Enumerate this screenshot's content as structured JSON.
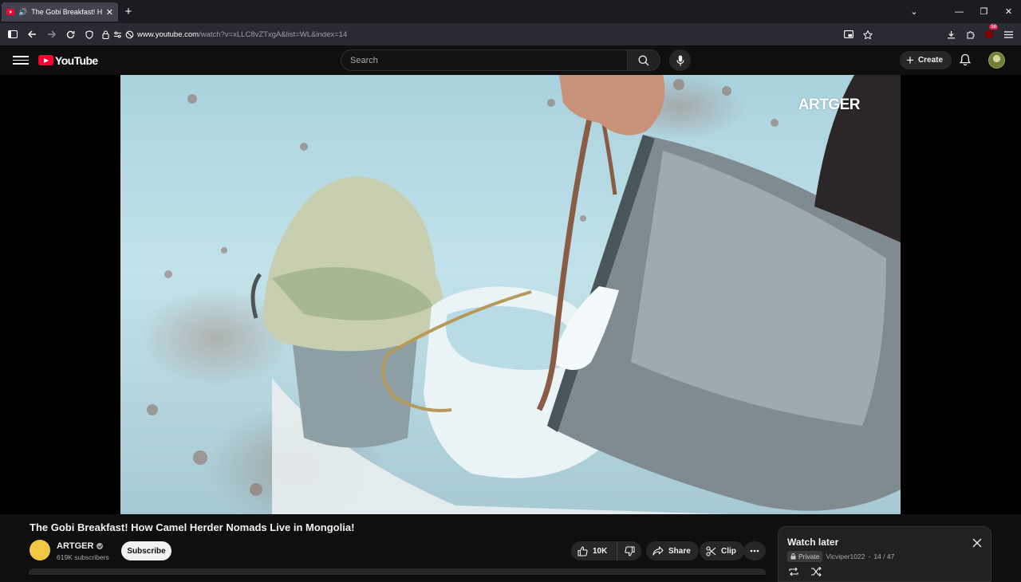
{
  "browser": {
    "tab_title": "The Gobi Breakfast! How C",
    "url_host": "www.youtube.com",
    "url_path": "/watch?v=xLLC8vZTxgA&list=WL&index=14",
    "extension_badge": "56"
  },
  "masthead": {
    "logo_text": "YouTube",
    "search_placeholder": "Search",
    "create_label": "Create"
  },
  "video": {
    "watermark": "ARTGER",
    "title": "The Gobi Breakfast! How Camel Herder Nomads Live in Mongolia!"
  },
  "channel": {
    "name": "ARTGER",
    "subscribers": "619K subscribers",
    "subscribe_label": "Subscribe"
  },
  "actions": {
    "likes": "10K",
    "share_label": "Share",
    "clip_label": "Clip"
  },
  "playlist": {
    "title": "Watch later",
    "privacy": "Private",
    "owner": "Vicviper1022",
    "position": "14 / 47"
  },
  "colors": {
    "brand_red": "#ff0033",
    "background": "#0f0f0f",
    "chip": "#272727"
  }
}
